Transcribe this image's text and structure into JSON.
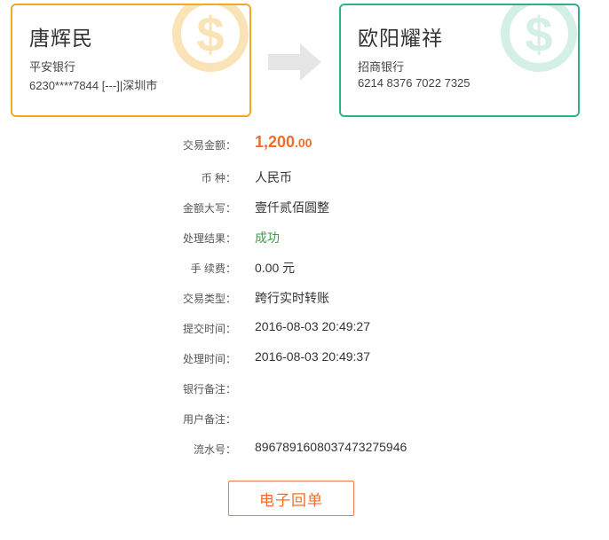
{
  "colors": {
    "payer_border": "#f5a623",
    "payee_border": "#2bb28c",
    "amount": "#f26d2b",
    "success": "#3aa142",
    "button": "#f26d2b"
  },
  "payer": {
    "name": "唐辉民",
    "bank": "平安银行",
    "account": "6230****7844 [---]|深圳市",
    "watermark_icon": "dollar-coin-icon"
  },
  "transfer_icon": "arrow-right-icon",
  "payee": {
    "name": "欧阳耀祥",
    "bank": "招商银行",
    "account": "6214 8376 7022 7325",
    "watermark_icon": "dollar-coin-icon"
  },
  "details": {
    "amount": {
      "label": "交易金额：",
      "value_main": "1,200",
      "value_cents": ".00"
    },
    "currency": {
      "label": "币 种：",
      "value": "人民币"
    },
    "amount_words": {
      "label": "金额大写：",
      "value": "壹仟贰佰圆整"
    },
    "result": {
      "label": "处理结果：",
      "value": "成功"
    },
    "fee": {
      "label": "手 续费：",
      "value": "0.00 元"
    },
    "type": {
      "label": "交易类型：",
      "value": "跨行实时转账"
    },
    "submit_time": {
      "label": "提交时间：",
      "value": "2016-08-03 20:49:27"
    },
    "process_time": {
      "label": "处理时间：",
      "value": "2016-08-03 20:49:37"
    },
    "bank_note": {
      "label": "银行备注：",
      "value": ""
    },
    "user_note": {
      "label": "用户备注：",
      "value": ""
    },
    "serial": {
      "label": "流水号：",
      "value": "896789160803747327594​6"
    }
  },
  "receipt_button": "电子回单"
}
